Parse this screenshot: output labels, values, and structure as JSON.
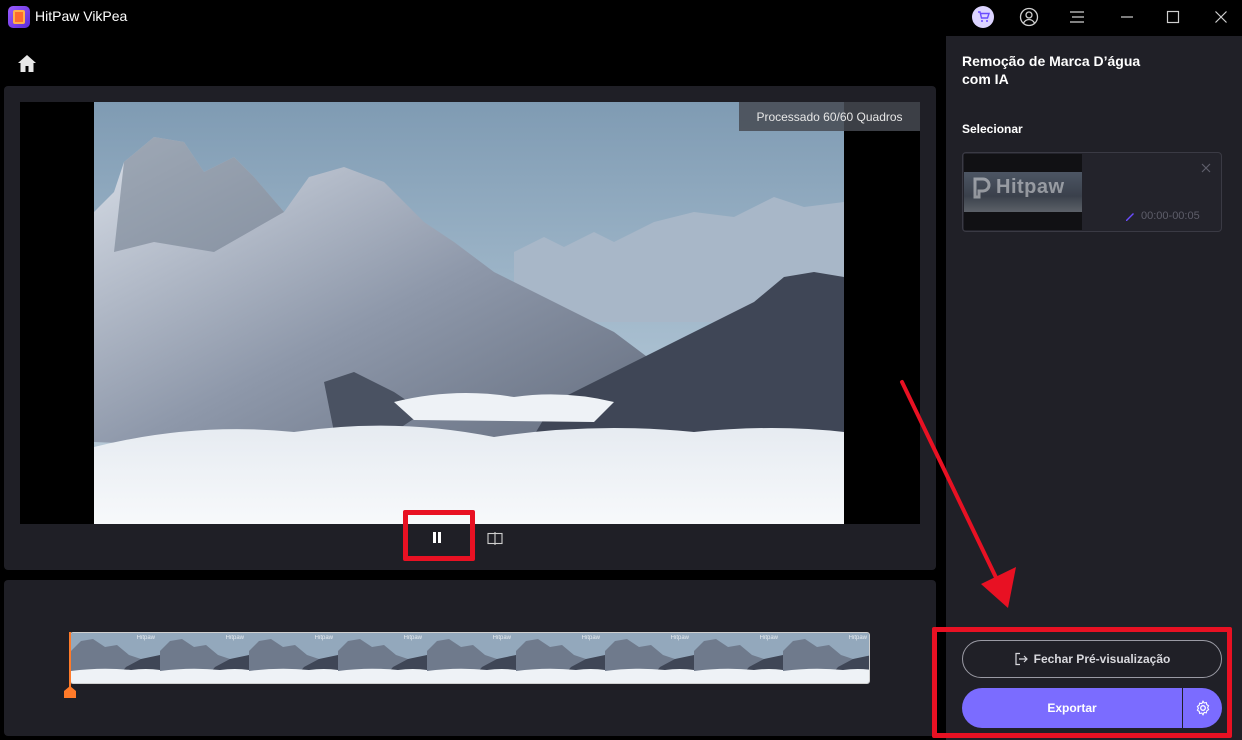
{
  "window": {
    "app_title": "HitPaw VikPea"
  },
  "preview": {
    "frames_badge": "Processado 60/60 Quadros"
  },
  "panel": {
    "title": "Remoção de Marca D’água com IA",
    "select_label": "Selecionar",
    "clip": {
      "watermark_text": "Hitpaw",
      "duration": "00:00-00:05"
    },
    "close_preview_label": "Fechar Pré-visualização",
    "export_label": "Exportar"
  },
  "timeline": {
    "frame_watermark": "Hitpaw",
    "frame_count": 9
  },
  "colors": {
    "accent": "#7b6cff",
    "highlight": "#e81123",
    "playhead": "#ff7a29",
    "panel": "#202027"
  },
  "icons": [
    "app-logo-icon",
    "cart-icon",
    "account-icon",
    "menu-icon",
    "minimize-icon",
    "maximize-icon",
    "close-icon",
    "home-icon",
    "pause-icon",
    "compare-icon",
    "remove-icon",
    "edit-icon",
    "exit-icon",
    "gear-icon"
  ]
}
